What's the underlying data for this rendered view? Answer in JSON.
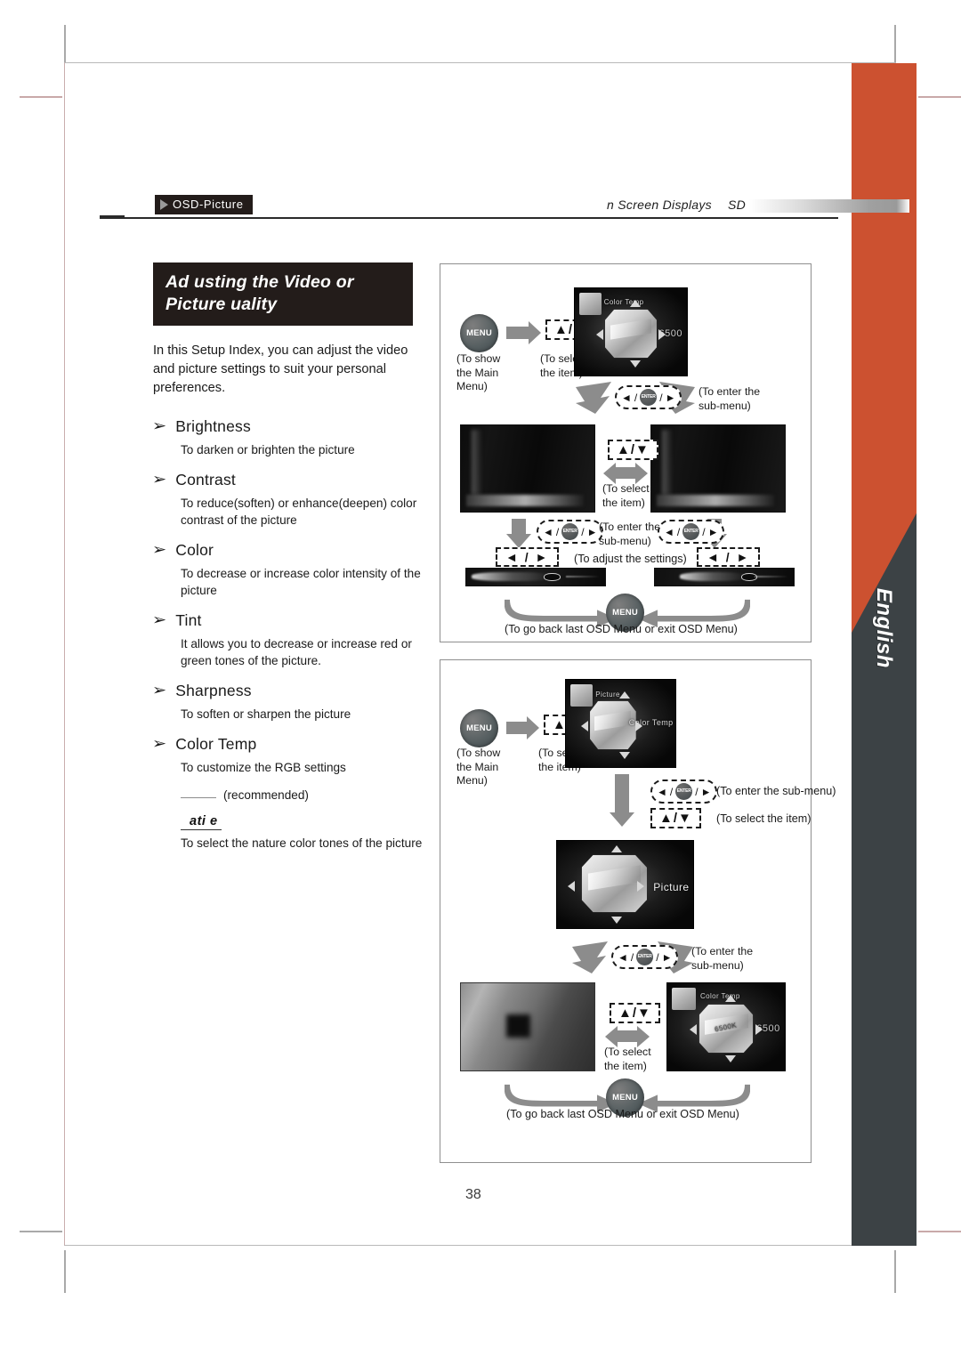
{
  "document": {
    "page_number": "38",
    "language_tab": "English",
    "running_head": {
      "section_tag": "OSD-Picture",
      "right_text": "n Screen Displays",
      "right_text_2": "SD"
    }
  },
  "content": {
    "title_line_1": "Ad usting the Video or",
    "title_line_2": "Picture   uality",
    "intro": "In this Setup Index, you can adjust the video and picture settings to suit your personal preferences.",
    "bullet_glyph": "➢",
    "items": [
      {
        "name": "Brightness",
        "desc": "To darken or brighten the picture"
      },
      {
        "name": "Contrast",
        "desc": "To reduce(soften) or enhance(deepen) color contrast of the picture"
      },
      {
        "name": "Color",
        "desc": "To decrease or increase color intensity of the picture"
      },
      {
        "name": "Tint",
        "desc": "It allows you to decrease or increase red or green tones of the picture."
      },
      {
        "name": "Sharpness",
        "desc": "To soften or sharpen the picture"
      },
      {
        "name": "Color Temp",
        "desc": "To customize the RGB settings"
      }
    ],
    "recommended_note": "(recommended)",
    "native_label": "ati  e",
    "native_desc": "To select the nature color tones of the picture"
  },
  "diagram_1": {
    "btn_menu": "MENU",
    "btn_updown": "▲/▼",
    "btn_lr": "◄ / ►",
    "btn_enter_label": "ENTER",
    "cap_menu": "(To show\nthe Main\nMenu)",
    "cap_select": "(To select\nthe item)",
    "cap_submenu": "(To enter the\nsub-menu)",
    "cap_select2": "(To select\nthe item)",
    "cap_submenu2": "(To enter the\nsub-menu)",
    "cap_adjust": "(To adjust the settings)",
    "cap_back": "(To go back last OSD Menu or exit OSD Menu)",
    "osd_title": "Color Temp",
    "osd_value": "6500"
  },
  "diagram_2": {
    "btn_menu": "MENU",
    "btn_updown": "▲/▼",
    "btn_enter_label": "ENTER",
    "cap_menu": "(To show\nthe Main\nMenu)",
    "cap_select": "(To select\nthe item)",
    "cap_submenu_inline": "(To enter the sub-menu)",
    "cap_select_inline": "(To select the item)",
    "cap_submenu": "(To enter the\nsub-menu)",
    "cap_select2": "(To select\nthe item)",
    "cap_back": "(To go back last OSD Menu or exit OSD Menu)",
    "osd_title_picture": "Picture",
    "osd_label_colortemp": "Color Temp",
    "osd_title": "Color Temp",
    "osd_value": "6500",
    "osd_value_inner": "6500K"
  },
  "colors": {
    "accent_orange": "#cc5130",
    "dark_gray": "#3c4245",
    "ink": "#231c1a"
  }
}
